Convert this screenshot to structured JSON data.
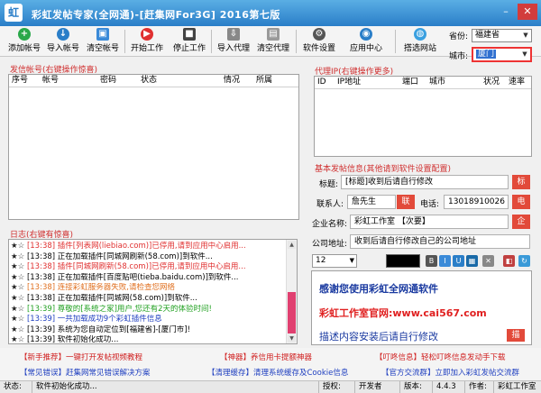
{
  "window": {
    "title": "彩虹发帖专家(全网通)-[赶集网For3G] 2016第七版",
    "minimize": "–",
    "close": "✕"
  },
  "toolbar": {
    "add_account": "添加帐号",
    "import_account": "导入帐号",
    "clear_account": "清空帐号",
    "start": "开始工作",
    "stop": "停止工作",
    "import_proxy": "导入代理",
    "clear_proxy": "清空代理",
    "settings": "软件设置",
    "app_center": "应用中心",
    "choose_site": "搭选网站",
    "province_label": "省份:",
    "province_value": "福建省",
    "city_label": "城市:",
    "city_value": "厦门"
  },
  "accounts": {
    "title": "发信帐号(右键操作惊喜)",
    "columns": [
      "序号",
      "帐号",
      "密码",
      "状态",
      "情况",
      "所属"
    ]
  },
  "proxy": {
    "title": "代理IP(右键操作更多)",
    "columns": [
      "ID",
      "IP地址",
      "端口",
      "城市",
      "状况",
      "速率"
    ]
  },
  "log": {
    "title": "日志(右键有惊喜)",
    "lines": [
      {
        "star": "★☆",
        "text": "[13:38] 插件[列表网(liebiao.com)]已停用,请到应用中心启用...",
        "color": "#e03030"
      },
      {
        "star": "★☆",
        "text": "[13:38] 正在加载插件[同城网刷新(58.com)]到软件...",
        "color": "#000000"
      },
      {
        "star": "★☆",
        "text": "[13:38] 插件[同城网刷新(58.com)]已停用,请到应用中心启用...",
        "color": "#e03030"
      },
      {
        "star": "★☆",
        "text": "[13:38] 正在加载插件[百度贴吧(tieba.baidu.com)]到软件...",
        "color": "#000000"
      },
      {
        "star": "★☆",
        "text": "[13:38] 连接彩虹服务器失败,请检查您网络",
        "color": "#e07020"
      },
      {
        "star": "★☆",
        "text": "[13:38] 正在加载插件[同城网(58.com)]到软件...",
        "color": "#000000"
      },
      {
        "star": "★☆",
        "text": "[13:39] 尊敬的[系统之家]用户,您还有2天的体验时间!",
        "color": "#20a020"
      },
      {
        "star": "★☆",
        "text": "[13:39] 一共加载成功9个彩虹插件信息",
        "color": "#2040c0"
      },
      {
        "star": "★☆",
        "text": "[13:39] 系统为您自动定位到[福建省]-[厦门市]!",
        "color": "#000000"
      },
      {
        "star": "★☆",
        "text": "[13:39] 软件初始化成功...",
        "color": "#000000"
      }
    ]
  },
  "post": {
    "title": "基本发帖信息(其他请到软件设置配置)",
    "title_label": "标题:",
    "title_value": "[标题]收到后请自行修改",
    "title_btn": "标",
    "contact_label": "联系人:",
    "contact_value": "詹先生",
    "contact_btn": "联",
    "phone_label": "电话:",
    "phone_value": "13018910026",
    "phone_btn": "电",
    "company_label": "企业名称:",
    "company_value": "彩虹工作室 【次要】",
    "company_btn": "企",
    "address_label": "公司地址:",
    "address_value": "收到后请自行修改自己的公司地址"
  },
  "editor": {
    "font_size": "12",
    "line1": "感谢您使用彩虹全网通软件",
    "line2": "彩虹工作室官网:www.cai567.com",
    "line3": "描述内容安装后请自行修改",
    "badge": "描"
  },
  "links": [
    "【新手推荐】一键打开发帖视频教程",
    "【神器】养信用卡提额神器",
    "【叮咚信息】轻松叮咚信息发动手下载",
    "【常见错误】赶集网常见错误解决方案",
    "【清理缓存】清理系统缓存及Cookie信息",
    "【官方交流群】立即加入彩虹发帖交流群"
  ],
  "status": {
    "label": "状态:",
    "value": "软件初始化成功...",
    "auth_label": "授权:",
    "auth_value": "开发者",
    "version_label": "版本:",
    "version_value": "4.4.3",
    "author_label": "作者:",
    "author_value": "彩虹工作室"
  }
}
